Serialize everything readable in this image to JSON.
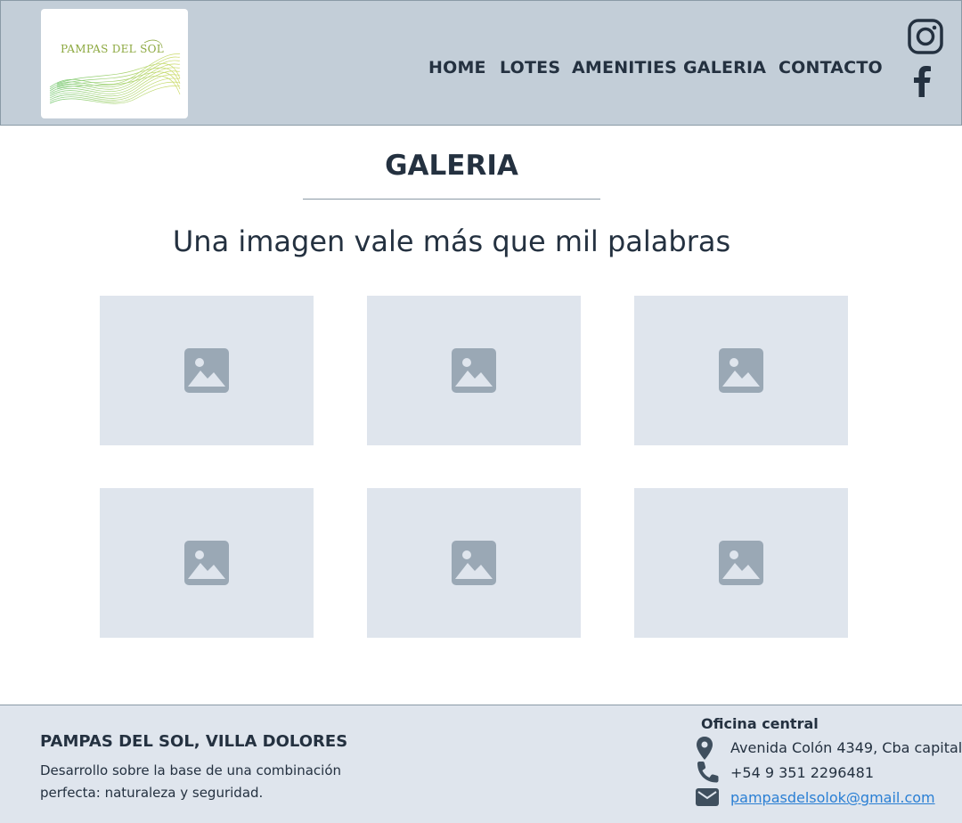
{
  "header": {
    "logo_text": "PAMPAS DEL SOL",
    "nav": [
      "HOME",
      "LOTES",
      "AMENITIES",
      "GALERIA",
      "CONTACTO"
    ],
    "social": [
      "instagram-icon",
      "facebook-icon"
    ]
  },
  "main": {
    "title": "GALERIA",
    "subtitle": "Una imagen vale más que mil palabras",
    "gallery_icon": "image-placeholder-icon"
  },
  "footer": {
    "title": "PAMPAS DEL SOL, VILLA DOLORES",
    "description": "Desarrollo sobre la base de una combinación perfecta: naturaleza y seguridad.",
    "office_title": "Oficina central",
    "address": "Avenida Colón 4349, Cba capital",
    "phone": "+54 9 351 2296481",
    "email": "pampasdelsolok@gmail.com"
  },
  "colors": {
    "header_bg": "#c3ced8",
    "footer_bg": "#dfe5ed",
    "text_dark": "#243140",
    "link": "#2a7fd4",
    "placeholder_icon": "#9aa8b5"
  }
}
